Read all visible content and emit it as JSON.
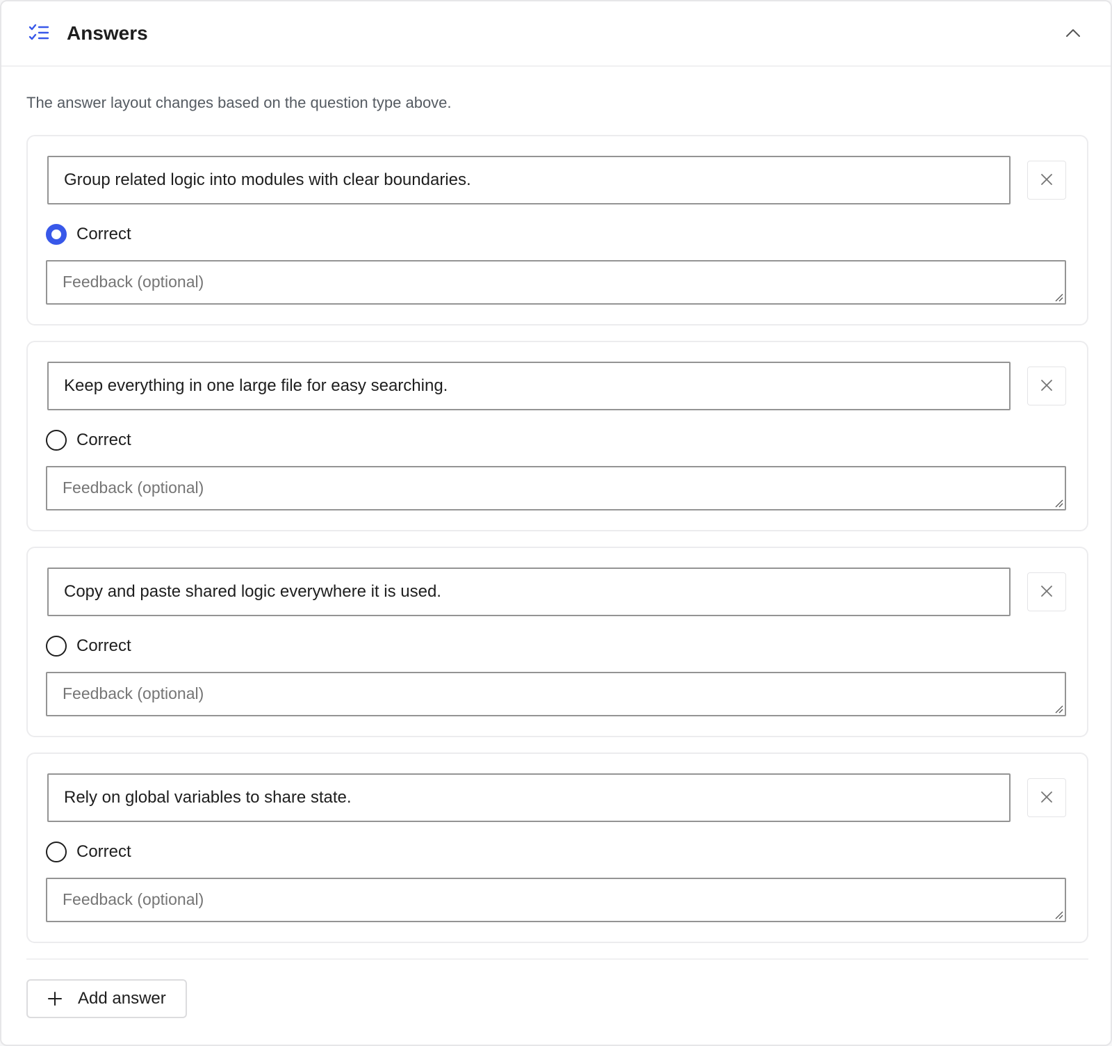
{
  "header": {
    "title": "Answers",
    "icon": "checklist-icon",
    "collapse_icon": "chevron-up-icon",
    "accent_color": "#3858e9"
  },
  "help_text": "The answer layout changes based on the question type above.",
  "answers": [
    {
      "text": "Group related logic into modules with clear boundaries.",
      "correct_label": "Correct",
      "correct": true,
      "feedback_placeholder": "Feedback (optional)",
      "feedback_value": ""
    },
    {
      "text": "Keep everything in one large file for easy searching.",
      "correct_label": "Correct",
      "correct": false,
      "feedback_placeholder": "Feedback (optional)",
      "feedback_value": ""
    },
    {
      "text": "Copy and paste shared logic everywhere it is used.",
      "correct_label": "Correct",
      "correct": false,
      "feedback_placeholder": "Feedback (optional)",
      "feedback_value": ""
    },
    {
      "text": "Rely on global variables to share state.",
      "correct_label": "Correct",
      "correct": false,
      "feedback_placeholder": "Feedback (optional)",
      "feedback_value": ""
    }
  ],
  "add_button": {
    "label": "Add answer",
    "icon": "plus-icon"
  }
}
